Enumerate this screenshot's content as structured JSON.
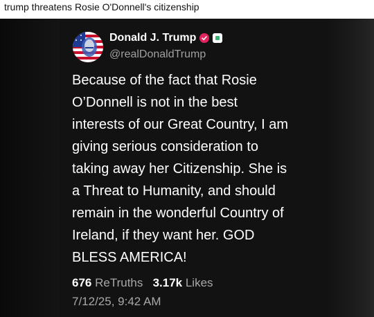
{
  "headline": "trump threatens Rosie O'Donnell's citizenship",
  "post": {
    "author_name": "Donald J. Trump",
    "handle": "@realDonaldTrump",
    "text": "Because of the fact that Rosie\nO’Donnell is not in the best\ninterests of our Great Country, I am\ngiving serious consideration to\ntaking away her Citizenship. She is\na Threat to Humanity, and should\nremain in the wonderful Country of\nIreland, if they want her. GOD\nBLESS AMERICA!",
    "retruths_count": "676",
    "retruths_label": "ReTruths",
    "likes_count": "3.17k",
    "likes_label": "Likes",
    "timestamp": "7/12/25, 9:42 AM"
  },
  "icons": {
    "avatar": "avatar-flag-portrait",
    "verified": "verified-check-icon",
    "secondary_badge": "badge-icon"
  },
  "colors": {
    "page_background": "#ffffff",
    "panel_background": "#000000",
    "card_background": "#121212",
    "text_primary": "#ffffff",
    "text_secondary": "#a8a8a8",
    "verified_badge": "#e0245e"
  }
}
